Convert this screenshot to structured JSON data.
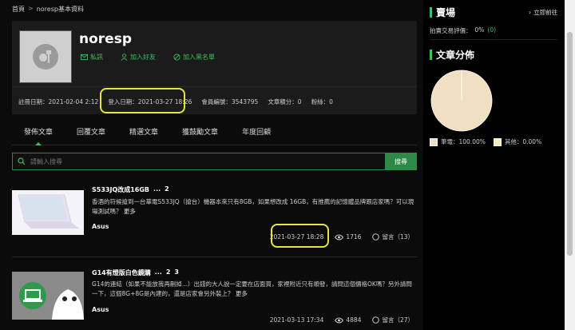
{
  "breadcrumb": {
    "home": "首頁",
    "sep": ">",
    "current": "noresp基本資料"
  },
  "profile": {
    "username": "noresp",
    "actions": {
      "message": "私訊",
      "add_friend": "加入好友",
      "blacklist": "加入黑名單"
    },
    "stats": {
      "register": "註冊日期：2021-02-04 2:12",
      "login": "登入日期：2021-03-27 18:26",
      "member_id": "會員編號：3543795",
      "article_points": "文章積分：0",
      "fans": "粉絲：0"
    }
  },
  "tabs": [
    "發佈文章",
    "回覆文章",
    "精選文章",
    "獲鼓勵文章",
    "年度回顧"
  ],
  "search": {
    "placeholder": "請輸入搜尋",
    "button": "搜尋"
  },
  "posts": [
    {
      "title": "S533JQ改成16GB",
      "ellipsis": "...",
      "page": "2",
      "body": "香酒的符候搶到一台華電S533JQ（搶台）機器本來只有8GB，如果想改成 16GB，有推薦的記憶體品牌跟店家嗎？可以現場測試嗎？",
      "more": "更多",
      "category": "Asus",
      "date": "2021-03-27 18:28",
      "views": "1716",
      "replies": "留言（13）"
    },
    {
      "title": "G14有燈版白色鏡購",
      "ellipsis": "...",
      "page": "2",
      "page2": "3",
      "body": "G14的連結（如果不能放我再刪掉...）出錢的大人說一定要在店面買，家裡附近只有順發，請問這個價格OK嗎？另外請問一下，這個8G+8G是內建的，還是店家會另外裝上？",
      "more": "更多",
      "category": "Asus",
      "date": "2021-03-13 17:34",
      "views": "4884",
      "replies": "留言（27）"
    }
  ],
  "sidebar": {
    "market_title": "賣場",
    "market_link": "立即前往",
    "rating": "拍賣交易評價：",
    "rating_value": "0%",
    "rating_count": "(0)",
    "dist_title": "文章分佈",
    "legend": [
      {
        "label": "筆電：100.00%",
        "color": "#f0dfc0"
      },
      {
        "label": "其他：0.00%",
        "color": "#f5efb0"
      }
    ]
  },
  "chart_data": {
    "type": "pie",
    "categories": [
      "筆電",
      "其他"
    ],
    "values": [
      100.0,
      0.0
    ],
    "colors": [
      "#f0dfc0",
      "#f5efb0"
    ]
  }
}
